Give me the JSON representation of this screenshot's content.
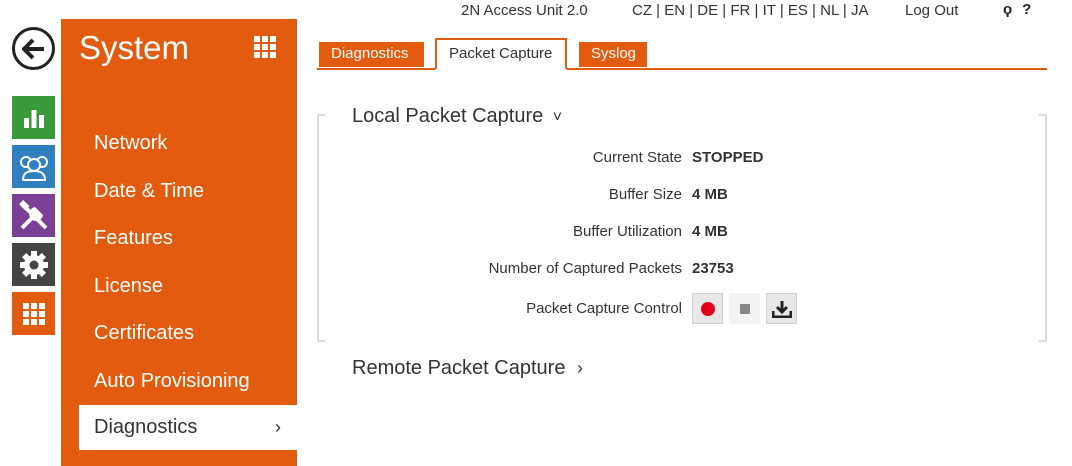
{
  "nav": {
    "back_icon": "arrow-left-icon",
    "side_icons": [
      "status-icon",
      "directory-icon",
      "hardware-icon",
      "services-icon",
      "system-icon"
    ]
  },
  "menu": {
    "title": "System",
    "items": [
      "Network",
      "Date & Time",
      "Features",
      "License",
      "Certificates",
      "Auto Provisioning",
      "Diagnostics"
    ],
    "active_chevron": "›"
  },
  "header": {
    "device_name": "2N Access Unit 2.0",
    "languages": "CZ | EN | DE | FR | IT | ES | NL | JA",
    "logout": "Log Out",
    "search_icon_glyph": "ϙ",
    "help_glyph": "?"
  },
  "tabs": [
    "Diagnostics",
    "Packet Capture",
    "Syslog"
  ],
  "local_capture": {
    "title": "Local Packet Capture",
    "chevron": "˅",
    "rows": [
      {
        "label": "Current State",
        "value": "STOPPED"
      },
      {
        "label": "Buffer Size",
        "value": "4 MB"
      },
      {
        "label": "Buffer Utilization",
        "value": "4 MB"
      },
      {
        "label": "Number of Captured Packets",
        "value": "23753"
      }
    ],
    "control_label": "Packet Capture Control"
  },
  "remote_capture": {
    "title": "Remote Packet Capture",
    "chevron": "›"
  },
  "colors": {
    "accent": "#e35b0e",
    "record": "#e3001b",
    "status_green": "#3a9a3a",
    "directory_blue": "#2f7fc1",
    "hardware_purple": "#7c3f98",
    "services_dark": "#444444"
  }
}
